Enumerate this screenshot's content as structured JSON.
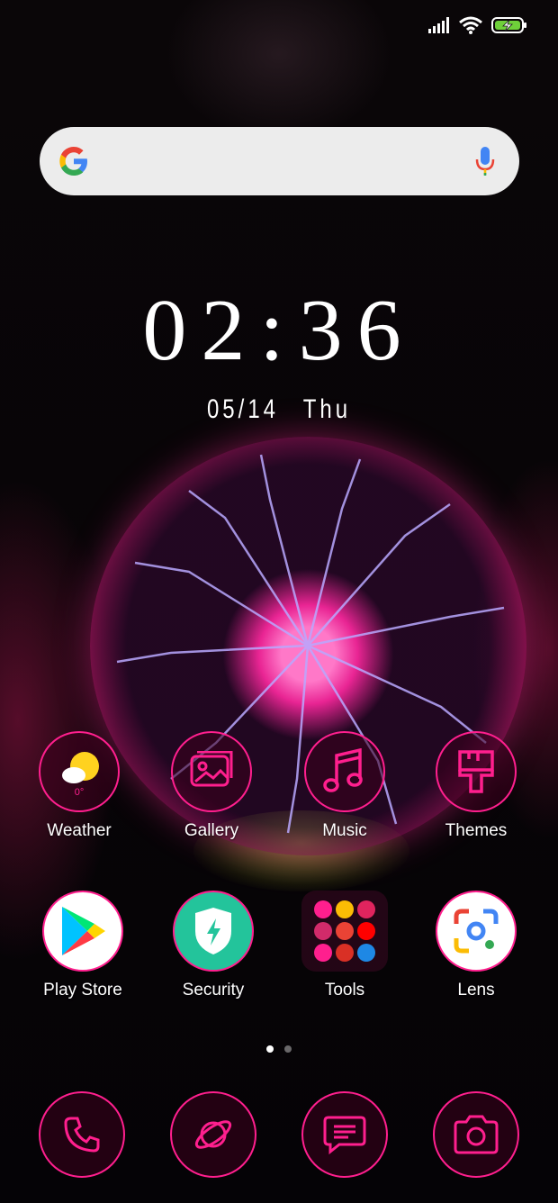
{
  "status_bar": {
    "icons": [
      "signal-icon",
      "wifi-icon",
      "battery-charging-icon"
    ],
    "battery_color": "#6fd03a"
  },
  "search": {
    "logo": "google-g-icon",
    "mic": "microphone-icon"
  },
  "clock": {
    "time": "02:36",
    "date": "05/14",
    "weekday": "Thu"
  },
  "apps_row1": [
    {
      "label": "Weather",
      "icon": "weather-icon",
      "temp": "0°"
    },
    {
      "label": "Gallery",
      "icon": "gallery-icon"
    },
    {
      "label": "Music",
      "icon": "music-note-icon"
    },
    {
      "label": "Themes",
      "icon": "paintbrush-icon"
    }
  ],
  "apps_row2": [
    {
      "label": "Play Store",
      "icon": "play-store-icon"
    },
    {
      "label": "Security",
      "icon": "security-shield-icon"
    },
    {
      "label": "Tools",
      "icon": "folder-icon"
    },
    {
      "label": "Lens",
      "icon": "google-lens-icon"
    }
  ],
  "page_indicator": {
    "pages": 2,
    "active": 1
  },
  "dock": [
    {
      "name": "phone",
      "icon": "phone-icon"
    },
    {
      "name": "browser",
      "icon": "planet-icon"
    },
    {
      "name": "messages",
      "icon": "message-icon"
    },
    {
      "name": "camera",
      "icon": "camera-icon"
    }
  ],
  "colors": {
    "accent": "#ff1f8e",
    "search_bg": "#ececec",
    "security_green": "#23c49b"
  }
}
